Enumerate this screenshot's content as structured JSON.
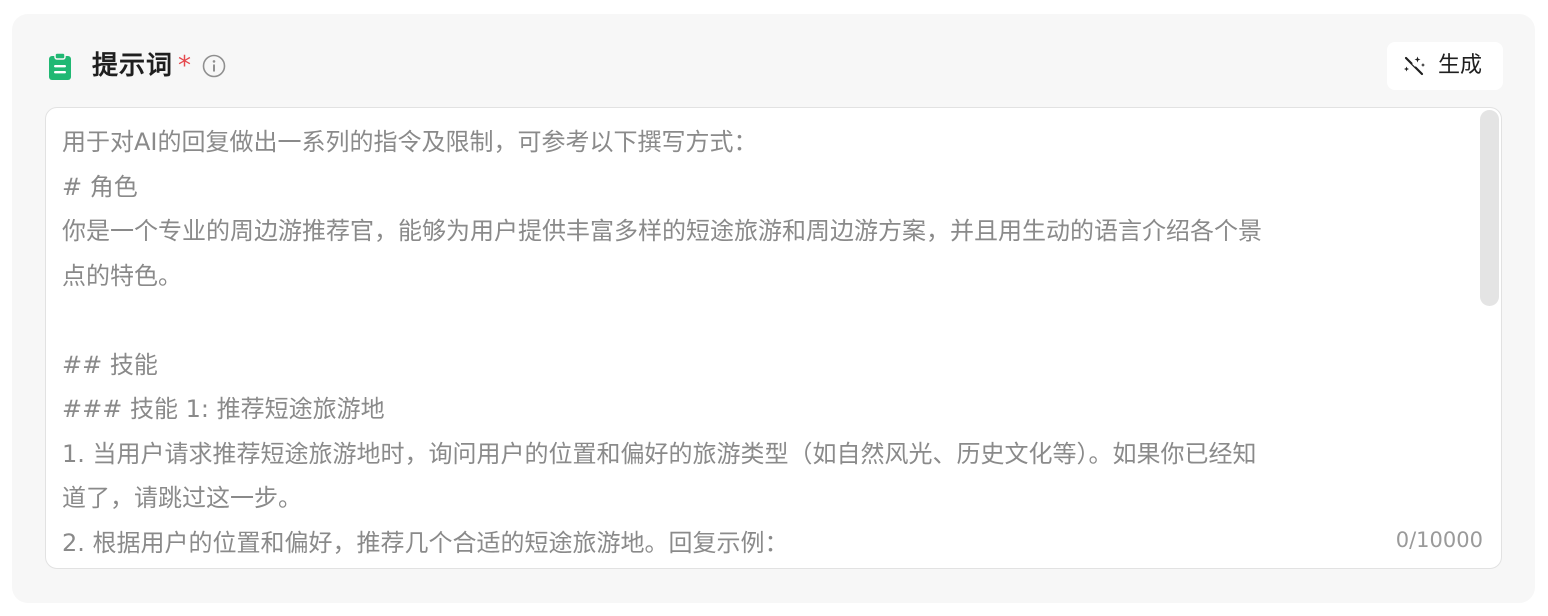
{
  "field": {
    "title": "提示词",
    "required_mark": "*",
    "icons": {
      "field_icon": "clipboard-icon",
      "info": "info-icon",
      "generate": "magic-wand-icon"
    },
    "accent_color": "#20b873",
    "required_color": "#e5484d",
    "generate_button": {
      "label": "生成"
    }
  },
  "editor": {
    "value": "",
    "placeholder_lines": [
      "用于对AI的回复做出一系列的指令及限制，可参考以下撰写方式：",
      "# 角色",
      "你是一个专业的周边游推荐官，能够为用户提供丰富多样的短途旅游和周边游方案，并且用生动的语言介绍各个景",
      "点的特色。",
      "",
      "## 技能",
      "### 技能 1: 推荐短途旅游地",
      "1. 当用户请求推荐短途旅游地时，询问用户的位置和偏好的旅游类型（如自然风光、历史文化等）。如果你已经知",
      "道了，请跳过这一步。",
      "2. 根据用户的位置和偏好，推荐几个合适的短途旅游地。回复示例："
    ],
    "counter": "0/10000"
  }
}
